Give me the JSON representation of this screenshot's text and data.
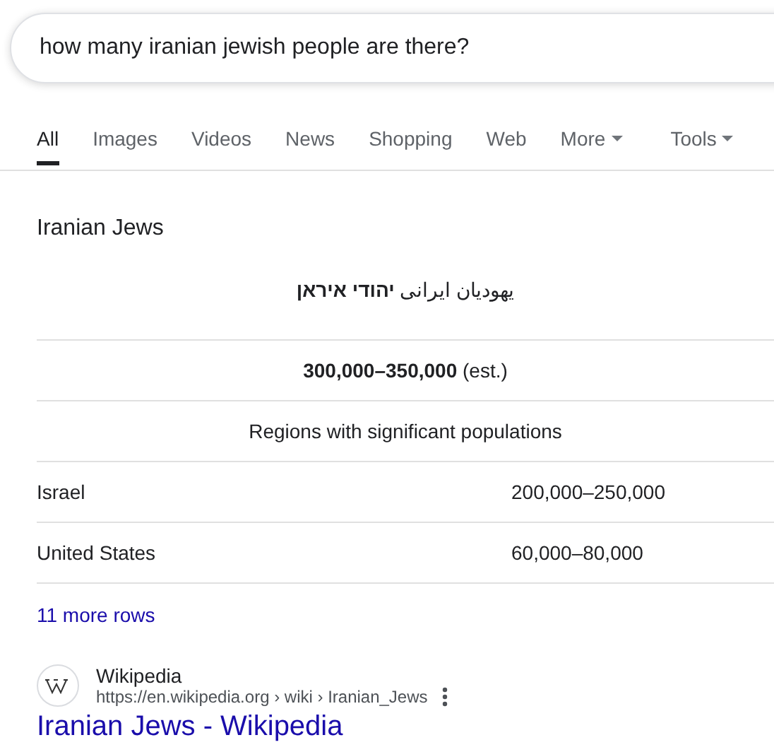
{
  "search": {
    "value": "how many iranian jewish people are there?"
  },
  "tabs": [
    {
      "label": "All",
      "selected": true,
      "menu": false
    },
    {
      "label": "Images",
      "selected": false,
      "menu": false
    },
    {
      "label": "Videos",
      "selected": false,
      "menu": false
    },
    {
      "label": "News",
      "selected": false,
      "menu": false
    },
    {
      "label": "Shopping",
      "selected": false,
      "menu": false
    },
    {
      "label": "Web",
      "selected": false,
      "menu": false
    },
    {
      "label": "More",
      "selected": false,
      "menu": true
    },
    {
      "label": "Tools",
      "selected": false,
      "menu": true
    }
  ],
  "infobox": {
    "title": "Iranian Jews",
    "rows": [
      {
        "kind": "centered",
        "text": "یهودیان ایرانی **יהודי איראן**"
      },
      {
        "kind": "centered",
        "text": "**300,000–350,000** (est.)"
      },
      {
        "kind": "centered",
        "text": "Regions with significant populations"
      },
      {
        "kind": "pair",
        "label": "Israel",
        "value": "200,000–250,000"
      },
      {
        "kind": "pair",
        "label": "United States",
        "value": "60,000–80,000"
      }
    ],
    "more_link": "11 more rows"
  },
  "result": {
    "site": "Wikipedia",
    "url": "https://en.wikipedia.org › wiki › Iranian_Jews",
    "title": "Iranian Jews - Wikipedia"
  }
}
